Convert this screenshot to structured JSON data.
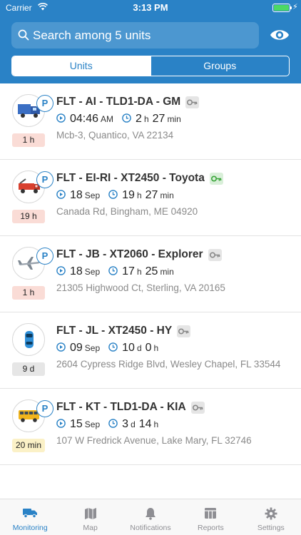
{
  "status_bar": {
    "carrier": "Carrier",
    "time": "3:13 PM",
    "battery_level": 1.0
  },
  "search": {
    "placeholder": "Search among 5 units"
  },
  "segments": {
    "units": "Units",
    "groups": "Groups",
    "selected": "Units"
  },
  "colors": {
    "header": "#2a82c6",
    "accent": "#2a82c6",
    "badge_red": "#fadcd6",
    "badge_grey": "#e6e6e6",
    "badge_yellow": "#fbf1c7",
    "key_green": "#3aa53a"
  },
  "units": [
    {
      "name": "FLT - AI - TLD1-DA - GM",
      "icon": "truck-icon",
      "key_status": "grey",
      "age": "1 h",
      "age_style": "red",
      "time_value": "04:46",
      "time_unit": "AM",
      "dur_1": "2",
      "dur_1_unit": "h",
      "dur_2": "27",
      "dur_2_unit": "min",
      "address": "Mcb-3, Quantico, VA 22134"
    },
    {
      "name": "FLT - EI-RI - XT2450 - Toyota",
      "icon": "tow-truck-icon",
      "key_status": "green",
      "age": "19 h",
      "age_style": "red",
      "time_value": "18",
      "time_unit": "Sep",
      "dur_1": "19",
      "dur_1_unit": "h",
      "dur_2": "27",
      "dur_2_unit": "min",
      "address": "Canada Rd, Bingham, ME 04920"
    },
    {
      "name": "FLT - JB - XT2060 - Explorer",
      "icon": "airplane-icon",
      "key_status": "grey",
      "age": "1 h",
      "age_style": "red",
      "time_value": "18",
      "time_unit": "Sep",
      "dur_1": "17",
      "dur_1_unit": "h",
      "dur_2": "25",
      "dur_2_unit": "min",
      "address": "21305 Highwood Ct, Sterling, VA 20165"
    },
    {
      "name": "FLT - JL - XT2450 - HY",
      "icon": "car-icon",
      "key_status": "grey",
      "age": "9 d",
      "age_style": "grey",
      "time_value": "09",
      "time_unit": "Sep",
      "dur_1": "10",
      "dur_1_unit": "d",
      "dur_2": "0",
      "dur_2_unit": "h",
      "address": "2604 Cypress Ridge Blvd, Wesley Chapel, FL 33544"
    },
    {
      "name": "FLT - KT - TLD1-DA - KIA",
      "icon": "bus-icon",
      "key_status": "grey",
      "age": "20 min",
      "age_style": "yellow",
      "time_value": "15",
      "time_unit": "Sep",
      "dur_1": "3",
      "dur_1_unit": "d",
      "dur_2": "14",
      "dur_2_unit": "h",
      "address": "107 W Fredrick Avenue, Lake Mary, FL 32746"
    }
  ],
  "badge_letter": "P",
  "tabs": [
    {
      "label": "Monitoring",
      "icon": "truck-icon",
      "active": true
    },
    {
      "label": "Map",
      "icon": "map-icon",
      "active": false
    },
    {
      "label": "Notifications",
      "icon": "bell-icon",
      "active": false
    },
    {
      "label": "Reports",
      "icon": "table-icon",
      "active": false
    },
    {
      "label": "Settings",
      "icon": "gear-icon",
      "active": false
    }
  ]
}
